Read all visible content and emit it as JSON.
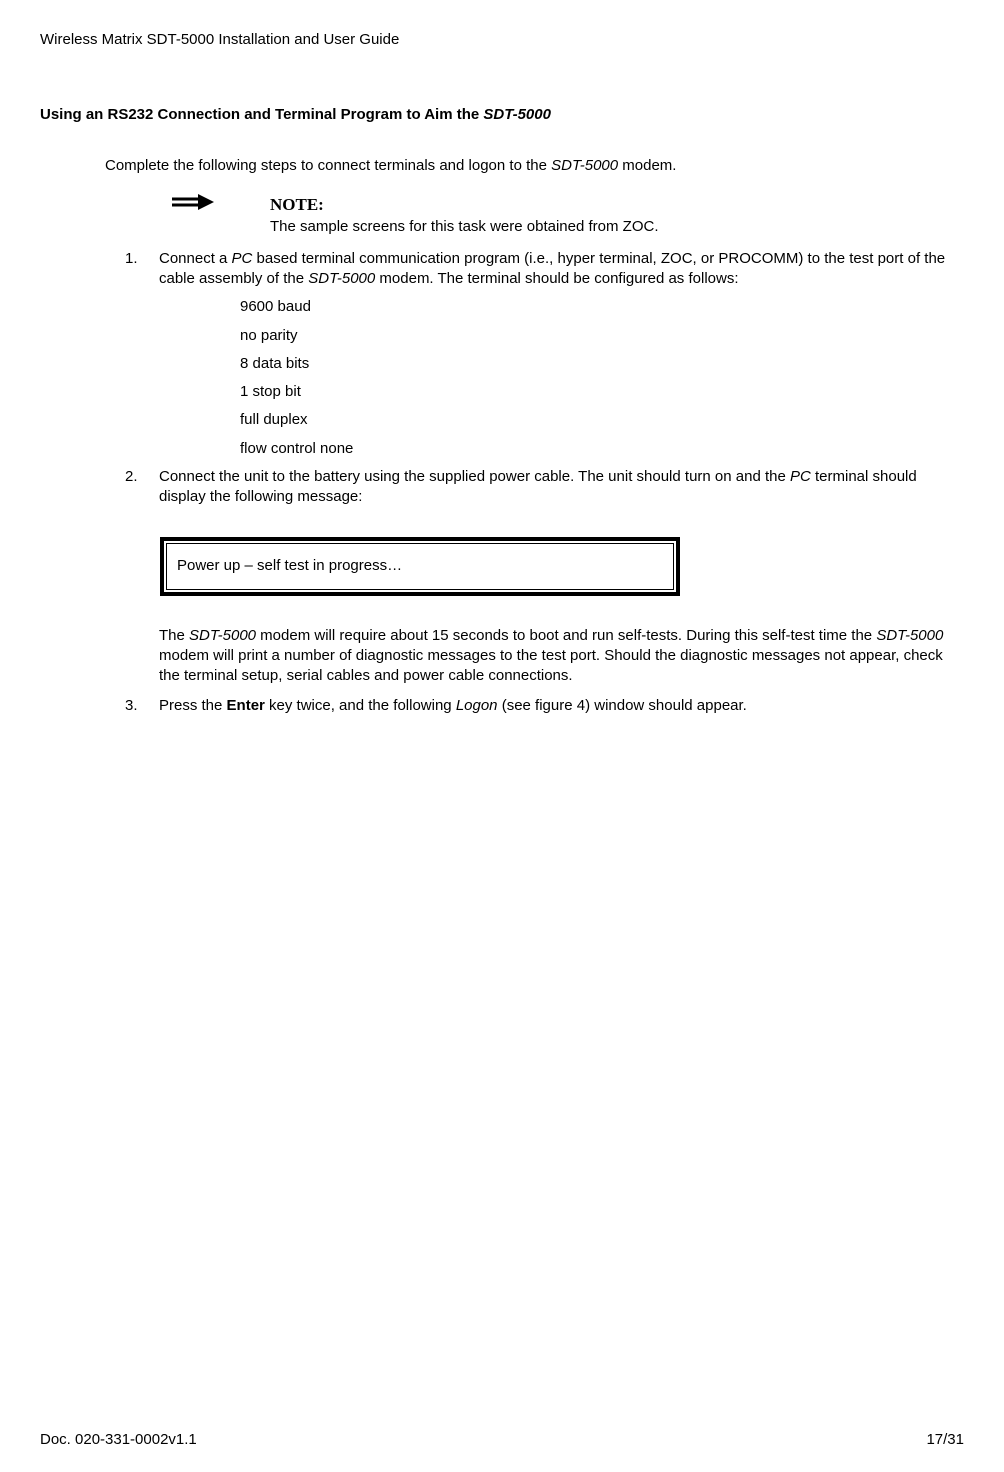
{
  "header": "Wireless Matrix SDT-5000 Installation and User Guide",
  "section": {
    "heading_pre": "Using an RS232 Connection and Terminal Program to Aim the ",
    "heading_ital": "SDT-5000"
  },
  "intro": {
    "pre": "Complete the following steps to connect terminals and logon to the ",
    "ital": "SDT-5000",
    "post": " modem."
  },
  "note": {
    "label": "NOTE:",
    "body": "The sample screens for this task were obtained from ZOC."
  },
  "step1": {
    "num": "1.",
    "a": "Connect a ",
    "b_ital": "PC",
    "c": " based terminal communication program (i.e., hyper terminal, ZOC, or PROCOMM) to the test port of the cable assembly of the ",
    "d_ital": "SDT-5000",
    "e": " modem.  The terminal should be configured as follows:"
  },
  "config": {
    "l1": "9600 baud",
    "l2": "no parity",
    "l3": "8 data bits",
    "l4": "1 stop bit",
    "l5": "full duplex",
    "l6": "flow control none"
  },
  "step2": {
    "num": "2.",
    "a": "Connect the unit to the battery using the supplied power cable.  The unit should turn on and the ",
    "b_ital": "PC",
    "c": " terminal should display the following message:"
  },
  "terminal": "Power up – self test in progress…",
  "para": {
    "a": "The ",
    "b_ital": "SDT-5000",
    "c": " modem will require about 15 seconds to boot and run self-tests.  During this self-test time the ",
    "d_ital": "SDT-5000",
    "e": " modem will print a number of diagnostic messages to the test port.  Should the diagnostic messages not appear, check the terminal setup, serial cables and power cable connections."
  },
  "step3": {
    "num": "3.",
    "a": "Press the ",
    "b_bold": "Enter",
    "c": " key twice, and the following ",
    "d_ital": "Logon",
    "e": " (see figure 4) window should appear."
  },
  "footer": {
    "doc": "Doc. 020-331-0002v1.1",
    "page": "17/31"
  }
}
